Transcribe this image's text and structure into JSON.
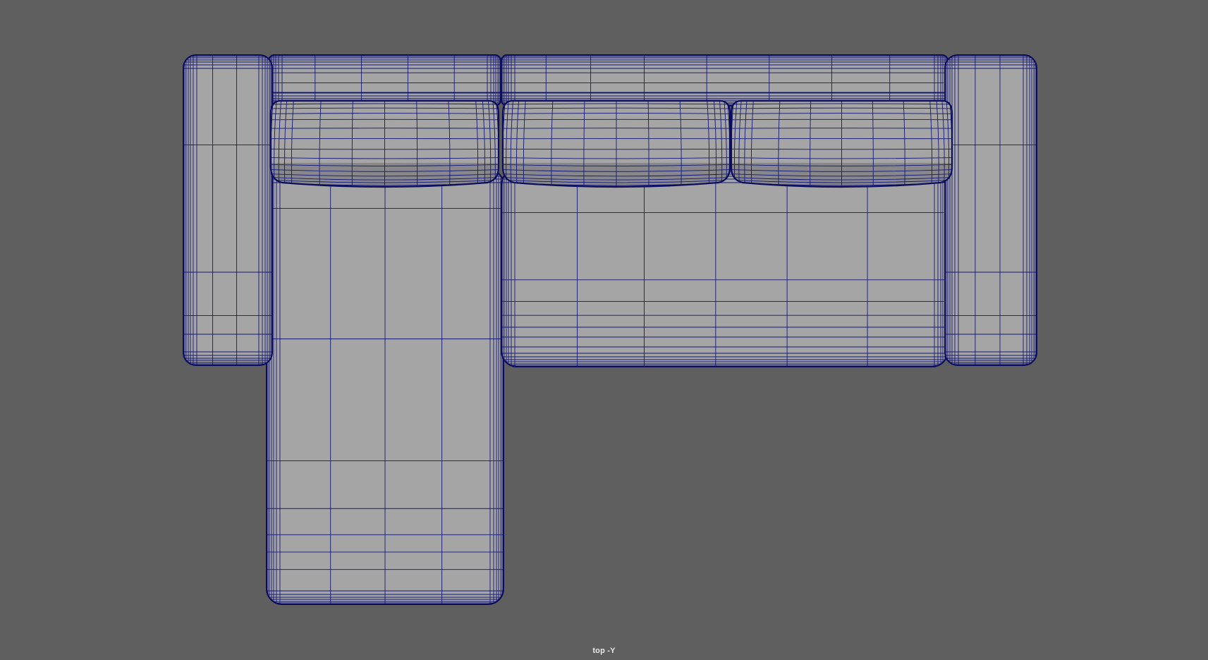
{
  "viewport": {
    "camera_label": "top -Y",
    "background_color": "#5f5f5f",
    "shading": "wireframe-on-shaded"
  },
  "colors": {
    "surface": "#a5a5a5",
    "surface_dark": "#8f8f8f",
    "wire": "#141675",
    "wire_dense": "#0b0d5c"
  },
  "model": {
    "name": "sofa",
    "parts": [
      "left-armrest",
      "right-armrest",
      "back-left",
      "back-right",
      "chaise-seat",
      "main-seat",
      "back-cushion-1",
      "back-cushion-2",
      "back-cushion-3"
    ]
  }
}
